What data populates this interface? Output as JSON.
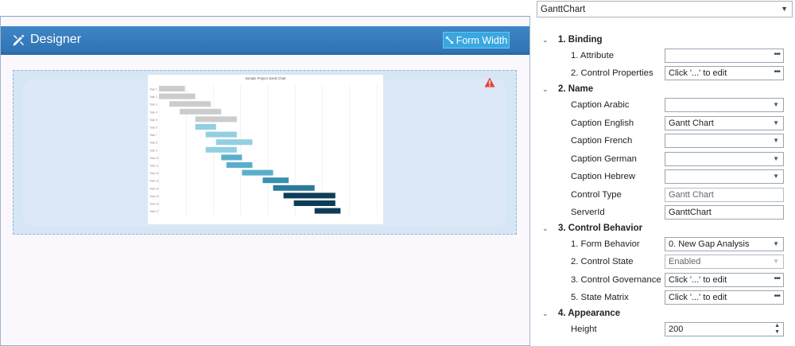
{
  "designer": {
    "title": "Designer",
    "form_width_label": "Form Width",
    "accent_color": "#2f73b3"
  },
  "chart_data": {
    "type": "bar",
    "title": "Sample Project Gantt Chart",
    "categories": [
      "Task 1",
      "Task 2",
      "Task 3",
      "Task 4",
      "Task 5",
      "Task 6",
      "Task 7",
      "Task 8",
      "Task 9",
      "Task 10",
      "Task 11",
      "Task 12",
      "Task 13",
      "Task 14",
      "Task 15",
      "Task 16",
      "Task 17"
    ],
    "starts": [
      0,
      0,
      2,
      4,
      7,
      7,
      9,
      11,
      9,
      12,
      13,
      16,
      20,
      22,
      24,
      26,
      30
    ],
    "durations": [
      5,
      7,
      8,
      8,
      8,
      4,
      6,
      7,
      6,
      4,
      5,
      6,
      5,
      8,
      10,
      8,
      5
    ],
    "colors": [
      "#cccccc",
      "#cccccc",
      "#cccccc",
      "#cccccc",
      "#cccccc",
      "#92cfe0",
      "#92cfe0",
      "#92cfe0",
      "#92cfe0",
      "#5aaecb",
      "#5aaecb",
      "#5aaecb",
      "#3b8fb0",
      "#2a7a9b",
      "#0f3d57",
      "#0f3d57",
      "#0f3d57"
    ],
    "xlim": [
      0,
      42
    ],
    "grid": true
  },
  "properties": {
    "selector_value": "GanttChart",
    "sections": {
      "binding": "1. Binding",
      "name": "2. Name",
      "behavior": "3. Control Behavior",
      "appearance": "4. Appearance"
    },
    "binding": {
      "attribute_label": "1. Attribute",
      "attribute_value": "",
      "control_properties_label": "2. Control Properties",
      "control_properties_value": "Click '...' to edit"
    },
    "name": {
      "caption_arabic_label": "Caption Arabic",
      "caption_arabic_value": "",
      "caption_english_label": "Caption English",
      "caption_english_value": "Gantt Chart",
      "caption_french_label": "Caption French",
      "caption_french_value": "",
      "caption_german_label": "Caption German",
      "caption_german_value": "",
      "caption_hebrew_label": "Caption Hebrew",
      "caption_hebrew_value": "",
      "control_type_label": "Control Type",
      "control_type_value": "Gantt Chart",
      "server_id_label": "ServerId",
      "server_id_value": "GanttChart"
    },
    "behavior": {
      "form_behavior_label": "1. Form Behavior",
      "form_behavior_value": "0. New Gap Analysis",
      "control_state_label": "2. Control State",
      "control_state_value": "Enabled",
      "control_governance_label": "3. Control Governance",
      "control_governance_value": "Click '...' to edit",
      "state_matrix_label": "5. State Matrix",
      "state_matrix_value": "Click '...' to edit"
    },
    "appearance": {
      "height_label": "Height",
      "height_value": "200"
    }
  }
}
